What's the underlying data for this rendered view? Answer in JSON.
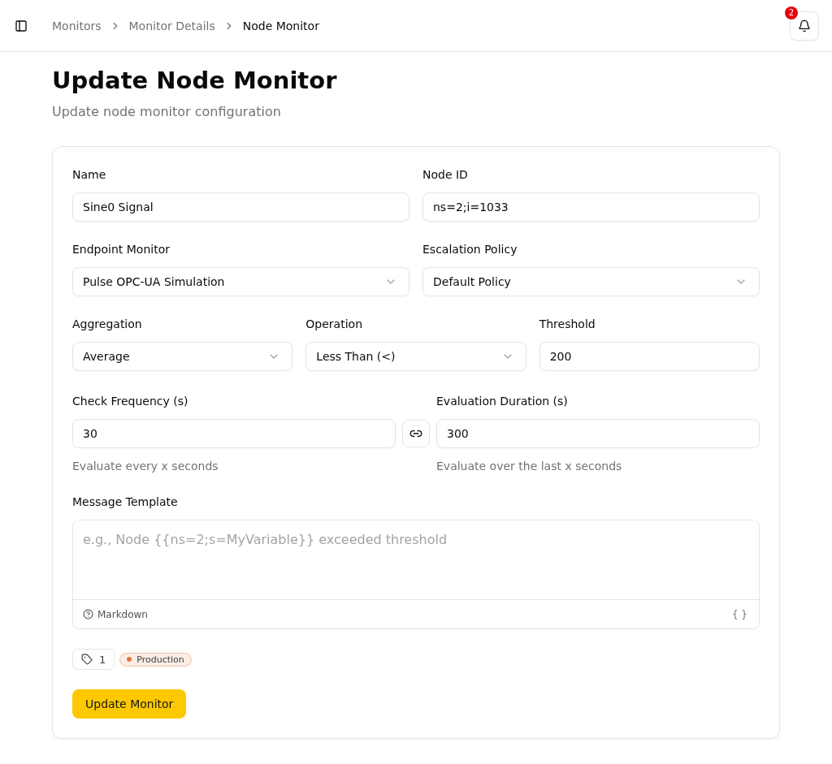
{
  "header": {
    "breadcrumbs": [
      {
        "label": "Monitors",
        "current": false
      },
      {
        "label": "Monitor Details",
        "current": false
      },
      {
        "label": "Node Monitor",
        "current": true
      }
    ],
    "notification_count": "2"
  },
  "page": {
    "title": "Update Node Monitor",
    "subtitle": "Update node monitor configuration"
  },
  "form": {
    "rows": [
      {
        "fields": [
          {
            "kind": "input",
            "label": "Name",
            "value": "Sine0 Signal"
          },
          {
            "kind": "input",
            "label": "Node ID",
            "value": "ns=2;i=1033"
          }
        ]
      },
      {
        "fields": [
          {
            "kind": "select",
            "label": "Endpoint Monitor",
            "value": "Pulse OPC-UA Simulation"
          },
          {
            "kind": "select",
            "label": "Escalation Policy",
            "value": "Default Policy"
          }
        ]
      },
      {
        "fields": [
          {
            "kind": "select",
            "label": "Aggregation",
            "value": "Average"
          },
          {
            "kind": "select",
            "label": "Operation",
            "value": "Less Than (<)"
          },
          {
            "kind": "input",
            "label": "Threshold",
            "value": "200"
          }
        ]
      }
    ],
    "timing": {
      "check_frequency": {
        "label": "Check Frequency (s)",
        "value": "30",
        "hint": "Evaluate every x seconds"
      },
      "evaluation_duration": {
        "label": "Evaluation Duration (s)",
        "value": "300",
        "hint": "Evaluate over the last x seconds"
      }
    },
    "message_template": {
      "label": "Message Template",
      "placeholder": "e.g., Node {{ns=2;s=MyVariable}} exceeded threshold",
      "help_link": "Markdown",
      "variables_button": "{ }"
    },
    "tags": {
      "count": "1",
      "items": [
        {
          "label": "Production",
          "color": "#d9773a"
        }
      ]
    },
    "submit_button": "Update Monitor"
  }
}
